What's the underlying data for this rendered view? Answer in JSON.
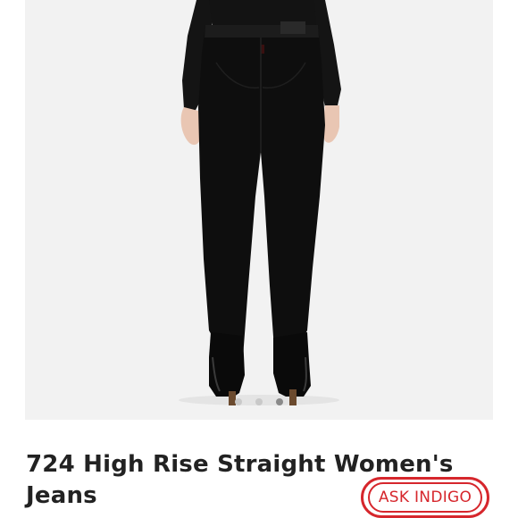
{
  "product": {
    "title": "724 High Rise Straight Women's Jeans",
    "image_alt": "Woman wearing black high-rise straight jeans, back view"
  },
  "carousel": {
    "dot_count": 3,
    "active_index": 2
  },
  "assistant_button": {
    "label": "ASK INDIGO"
  },
  "colors": {
    "accent": "#d6262c",
    "garment": "#0e0e0e",
    "background": "#f2f2f2"
  }
}
